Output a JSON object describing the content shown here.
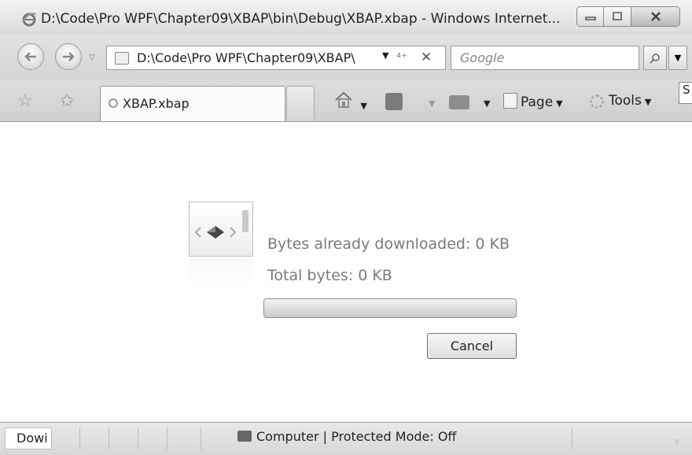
{
  "window": {
    "title": "D:\\Code\\Pro WPF\\Chapter09\\XBAP\\bin\\Debug\\XBAP.xbap - Windows Internet...",
    "minimize_icon": "minimize-icon",
    "maximize_icon": "maximize-icon",
    "close_icon": "close-icon"
  },
  "address_bar": {
    "url": "D:\\Code\\Pro WPF\\Chapter09\\XBAP\\",
    "search_placeholder": "Google"
  },
  "tabs": [
    {
      "label": "XBAP.xbap"
    }
  ],
  "side_tab": {
    "label": "S"
  },
  "toolbar": {
    "page_label": "Page",
    "tools_label": "Tools"
  },
  "download": {
    "bytes_downloaded": "Bytes already downloaded: 0 KB",
    "total_bytes": "Total bytes: 0 KB",
    "progress_fraction": 0,
    "cancel_label": "Cancel"
  },
  "status_bar": {
    "left_text": "Dowi",
    "zone_text": "Computer | Protected Mode: Off"
  },
  "colors": {
    "chrome_bg": "#d9d9d9",
    "content_bg": "#ffffff",
    "progress_fill": "#4ea830"
  }
}
